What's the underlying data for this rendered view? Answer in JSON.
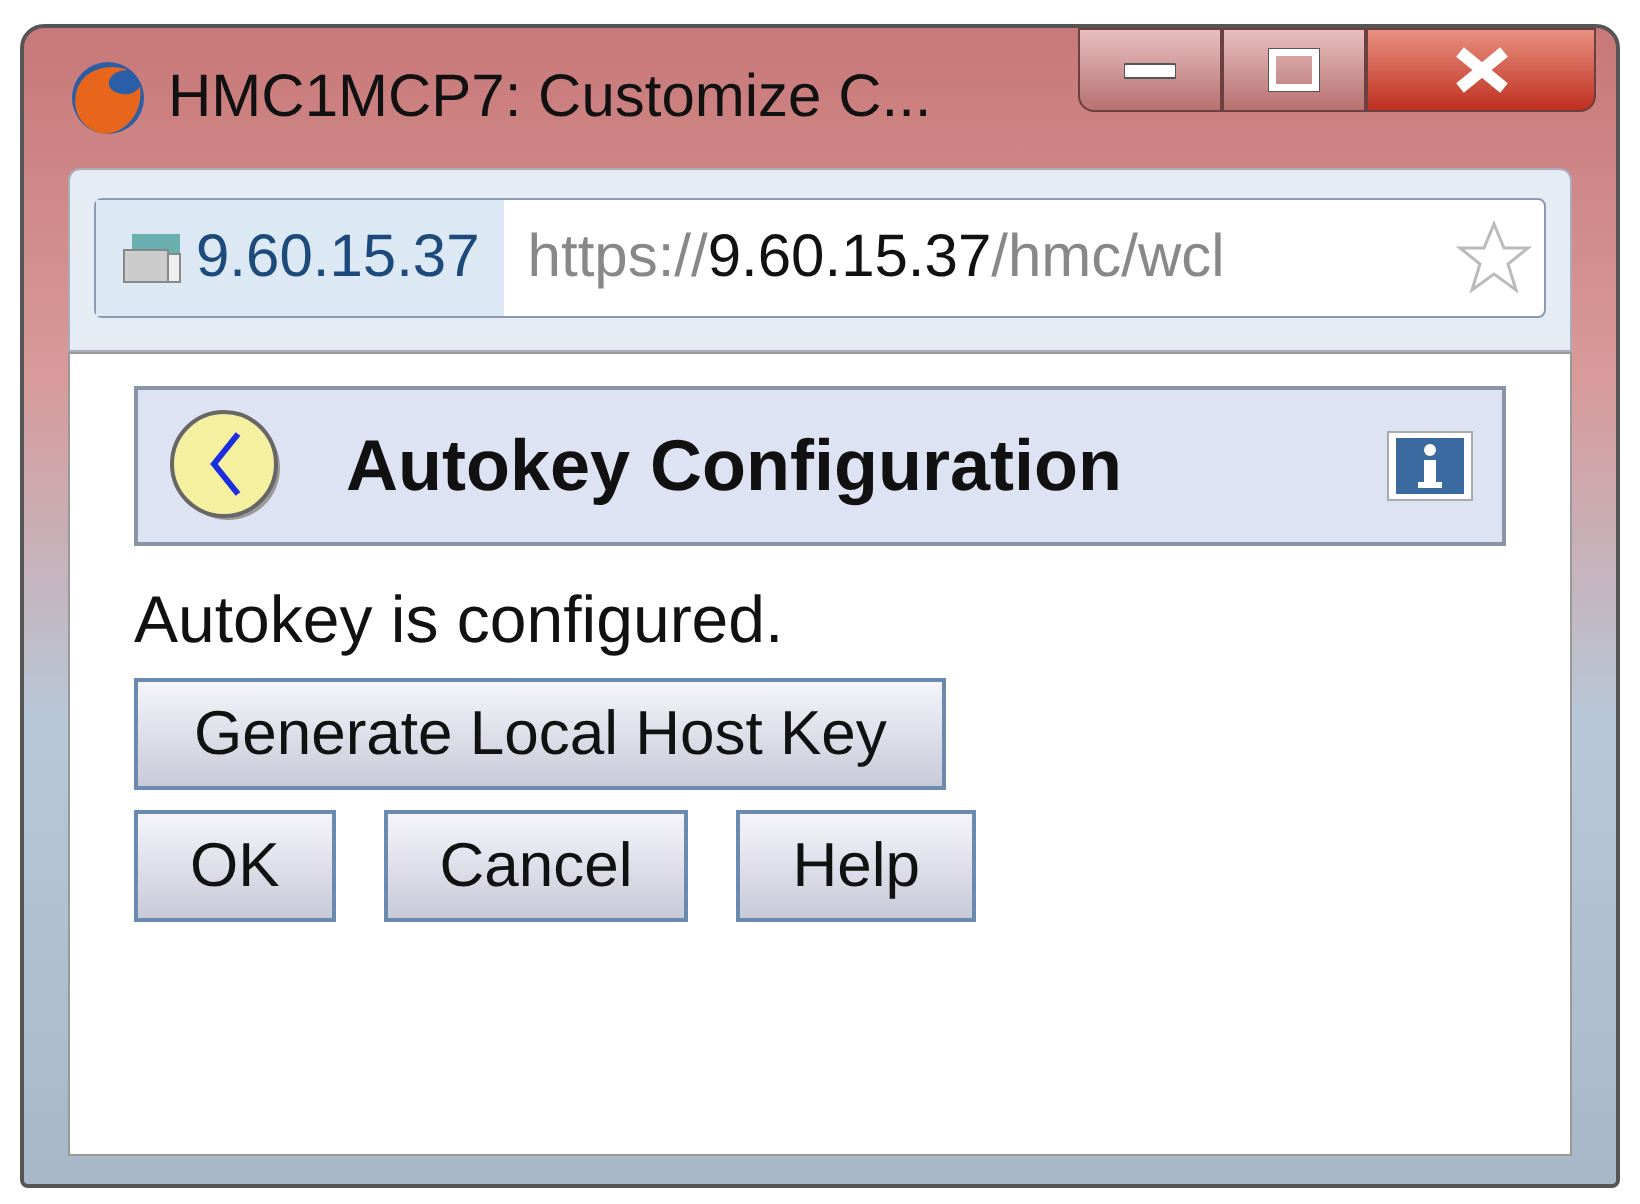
{
  "window": {
    "title": "HMC1MCP7: Customize C..."
  },
  "address_bar": {
    "site": "9.60.15.37",
    "url": {
      "scheme": "https://",
      "host": "9.60.15.37",
      "path": "/hmc/wcl"
    }
  },
  "header": {
    "title": "Autokey Configuration"
  },
  "message": "Autokey is configured.",
  "action_button": "Generate Local Host Key",
  "buttons": [
    "OK",
    "Cancel",
    "Help"
  ]
}
